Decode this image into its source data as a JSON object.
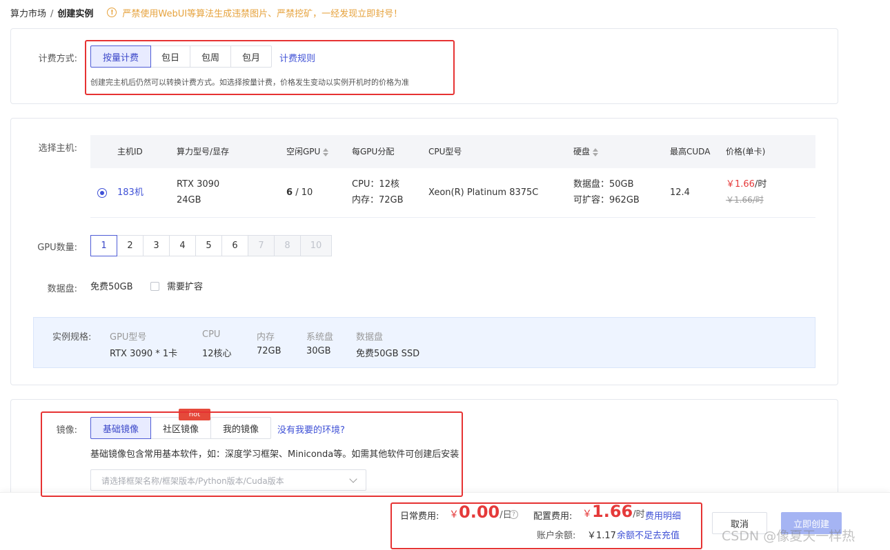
{
  "breadcrumb": {
    "parent": "算力市场",
    "separator": "/",
    "current": "创建实例"
  },
  "warning": {
    "icon": "warning-circle-icon",
    "text": "严禁使用WebUI等算法生成违禁图片、严禁挖矿，一经发现立即封号！"
  },
  "billing": {
    "label": "计费方式:",
    "options": [
      "按量计费",
      "包日",
      "包周",
      "包月"
    ],
    "selected": "按量计费",
    "rules_link": "计费规则",
    "hint": "创建完主机后仍然可以转换计费方式。如选择按量计费，价格发生变动以实例开机时的价格为准"
  },
  "host": {
    "label": "选择主机:",
    "columns": [
      "主机ID",
      "算力型号/显存",
      "空闲GPU",
      "每GPU分配",
      "CPU型号",
      "硬盘",
      "最高CUDA",
      "价格(单卡)"
    ],
    "row": {
      "id": "183机",
      "gpu_model": "RTX 3090",
      "vram": "24GB",
      "free_gpu": "6",
      "total_gpu": "/ 10",
      "cpu_alloc": "CPU：12核",
      "mem_alloc": "内存：72GB",
      "cpu_model": "Xeon(R) Platinum 8375C",
      "data_disk": "数据盘：50GB",
      "expandable": "可扩容：962GB",
      "cuda": "12.4",
      "price": "￥1.66",
      "price_unit": "/时",
      "original_price": "￥1.66/时"
    }
  },
  "gpu_count": {
    "label": "GPU数量:",
    "options": [
      "1",
      "2",
      "3",
      "4",
      "5",
      "6",
      "7",
      "8",
      "10"
    ],
    "selected": "1",
    "disabled": [
      "7",
      "8",
      "10"
    ]
  },
  "data_disk": {
    "label": "数据盘:",
    "value": "免费50GB",
    "expand_label": "需要扩容",
    "expand_checked": false
  },
  "spec": {
    "label": "实例规格:",
    "items": [
      {
        "key": "GPU型号",
        "value": "RTX 3090 * 1卡"
      },
      {
        "key": "CPU",
        "value": "12核心"
      },
      {
        "key": "内存",
        "value": "72GB"
      },
      {
        "key": "系统盘",
        "value": "30GB"
      },
      {
        "key": "数据盘",
        "value": "免费50GB SSD"
      }
    ]
  },
  "image": {
    "label": "镜像:",
    "tabs": [
      "基础镜像",
      "社区镜像",
      "我的镜像"
    ],
    "selected": "基础镜像",
    "hot_badge": "hot",
    "missing_link": "没有我要的环境?",
    "hint": "基础镜像包含常用基本软件，如：深度学习框架、Miniconda等。如需其他软件可创建后安装",
    "select_placeholder": "请选择框架名称/框架版本/Python版本/Cuda版本"
  },
  "footer": {
    "daily_label": "日常费用:",
    "daily_currency": "￥",
    "daily_value": "0.00",
    "daily_unit": "/日",
    "config_label": "配置费用:",
    "config_currency": "￥",
    "config_value": "1.66",
    "config_unit": "/时",
    "fee_detail_link": "费用明细",
    "balance_label": "账户余额:",
    "balance_value": "￥1.17",
    "recharge_link": "余额不足去充值",
    "cancel_label": "取消",
    "create_label": "立即创建"
  },
  "watermark": "CSDN @像夏天一样热",
  "colors": {
    "accent": "#3f51d6",
    "price_red": "#e53a3a",
    "warning": "#e6a23c",
    "annotation_red": "#e63232"
  }
}
